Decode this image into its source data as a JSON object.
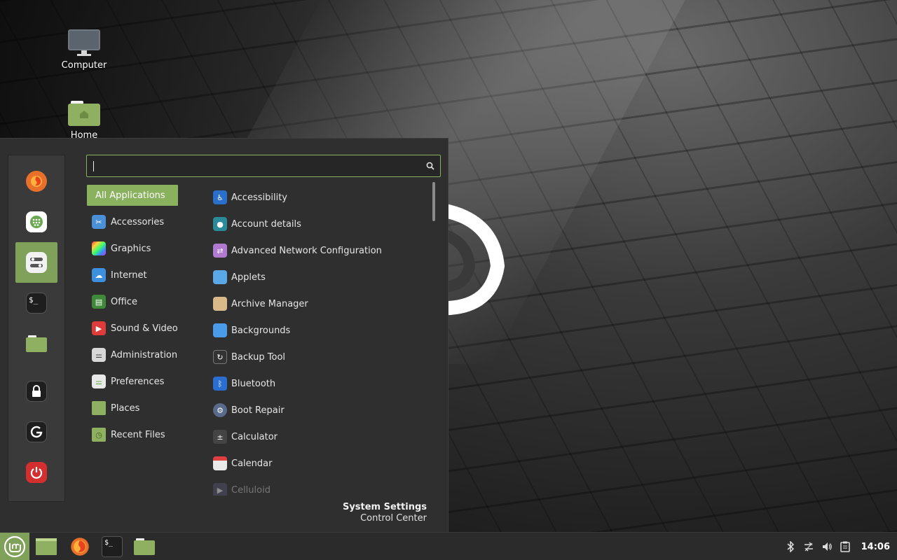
{
  "desktop": {
    "icons": [
      {
        "label": "Computer",
        "icon": "computer-icon"
      },
      {
        "label": "Home",
        "icon": "home-folder-icon"
      }
    ]
  },
  "menu": {
    "favorites": [
      {
        "name": "firefox",
        "icon": "firefox-icon",
        "color": "#e8702a"
      },
      {
        "name": "software-manager",
        "icon": "software-manager-icon",
        "color": "#ffffff"
      },
      {
        "name": "system-settings",
        "icon": "settings-toggles-icon",
        "color": "#f2f2f2",
        "active": true
      },
      {
        "name": "terminal",
        "icon": "terminal-icon",
        "color": "#222222",
        "glyph": "$_"
      },
      {
        "name": "files",
        "icon": "folder-icon",
        "color": "#8fb060"
      },
      {
        "name": "lock-screen",
        "icon": "lock-icon",
        "color": "#222222"
      },
      {
        "name": "logout",
        "icon": "logout-icon",
        "color": "#222222"
      },
      {
        "name": "quit",
        "icon": "power-icon",
        "color": "#d32f2f"
      }
    ],
    "search": {
      "value": "",
      "placeholder": ""
    },
    "categories": [
      {
        "label": "All Applications",
        "active": true
      },
      {
        "label": "Accessories",
        "icon": "accessories-icon",
        "color": "#4a90d9"
      },
      {
        "label": "Graphics",
        "icon": "graphics-icon",
        "color": "#c04fd0"
      },
      {
        "label": "Internet",
        "icon": "internet-icon",
        "color": "#3d8fe0"
      },
      {
        "label": "Office",
        "icon": "office-icon",
        "color": "#3f8a3a"
      },
      {
        "label": "Sound & Video",
        "icon": "sound-video-icon",
        "color": "#e03b3b"
      },
      {
        "label": "Administration",
        "icon": "administration-icon",
        "color": "#d8d8d8"
      },
      {
        "label": "Preferences",
        "icon": "preferences-icon",
        "color": "#e8e8e8"
      },
      {
        "label": "Places",
        "icon": "places-folder-icon",
        "color": "#8fb060"
      },
      {
        "label": "Recent Files",
        "icon": "recent-files-icon",
        "color": "#8fb060"
      }
    ],
    "apps": [
      {
        "label": "Accessibility",
        "icon": "accessibility-icon",
        "color": "#2a6fc9"
      },
      {
        "label": "Account details",
        "icon": "account-details-icon",
        "color": "#2a8a9a"
      },
      {
        "label": "Advanced Network Configuration",
        "icon": "network-config-icon",
        "color": "#b07ad0"
      },
      {
        "label": "Applets",
        "icon": "applets-icon",
        "color": "#5aa8e8"
      },
      {
        "label": "Archive Manager",
        "icon": "archive-manager-icon",
        "color": "#d9b98a"
      },
      {
        "label": "Backgrounds",
        "icon": "backgrounds-icon",
        "color": "#4a9be8"
      },
      {
        "label": "Backup Tool",
        "icon": "backup-tool-icon",
        "color": "#333333"
      },
      {
        "label": "Bluetooth",
        "icon": "bluetooth-icon",
        "color": "#2a6fd0"
      },
      {
        "label": "Boot Repair",
        "icon": "boot-repair-icon",
        "color": "#5a6a8a"
      },
      {
        "label": "Calculator",
        "icon": "calculator-icon",
        "color": "#444444"
      },
      {
        "label": "Calendar",
        "icon": "calendar-icon",
        "color": "#e9e9e9"
      },
      {
        "label": "Celluloid",
        "icon": "celluloid-icon",
        "color": "#555577",
        "faded": true
      }
    ],
    "description": {
      "name": "System Settings",
      "sub": "Control Center"
    }
  },
  "taskbar": {
    "launchers": [
      {
        "name": "show-desktop",
        "icon": "show-desktop-icon",
        "color": "#8fb060"
      },
      {
        "name": "firefox",
        "icon": "firefox-icon",
        "color": "#e8702a"
      },
      {
        "name": "terminal",
        "icon": "terminal-icon",
        "color": "#222222",
        "glyph": "$_"
      },
      {
        "name": "files",
        "icon": "folder-icon",
        "color": "#8fb060"
      }
    ],
    "tray": [
      "bluetooth-icon",
      "network-icon",
      "volume-icon",
      "clipboard-icon"
    ],
    "clock": "14:06"
  },
  "colors": {
    "accent": "#8ab15d",
    "menu_bg": "#2f2f2f",
    "taskbar_bg": "#2b2b2b"
  }
}
